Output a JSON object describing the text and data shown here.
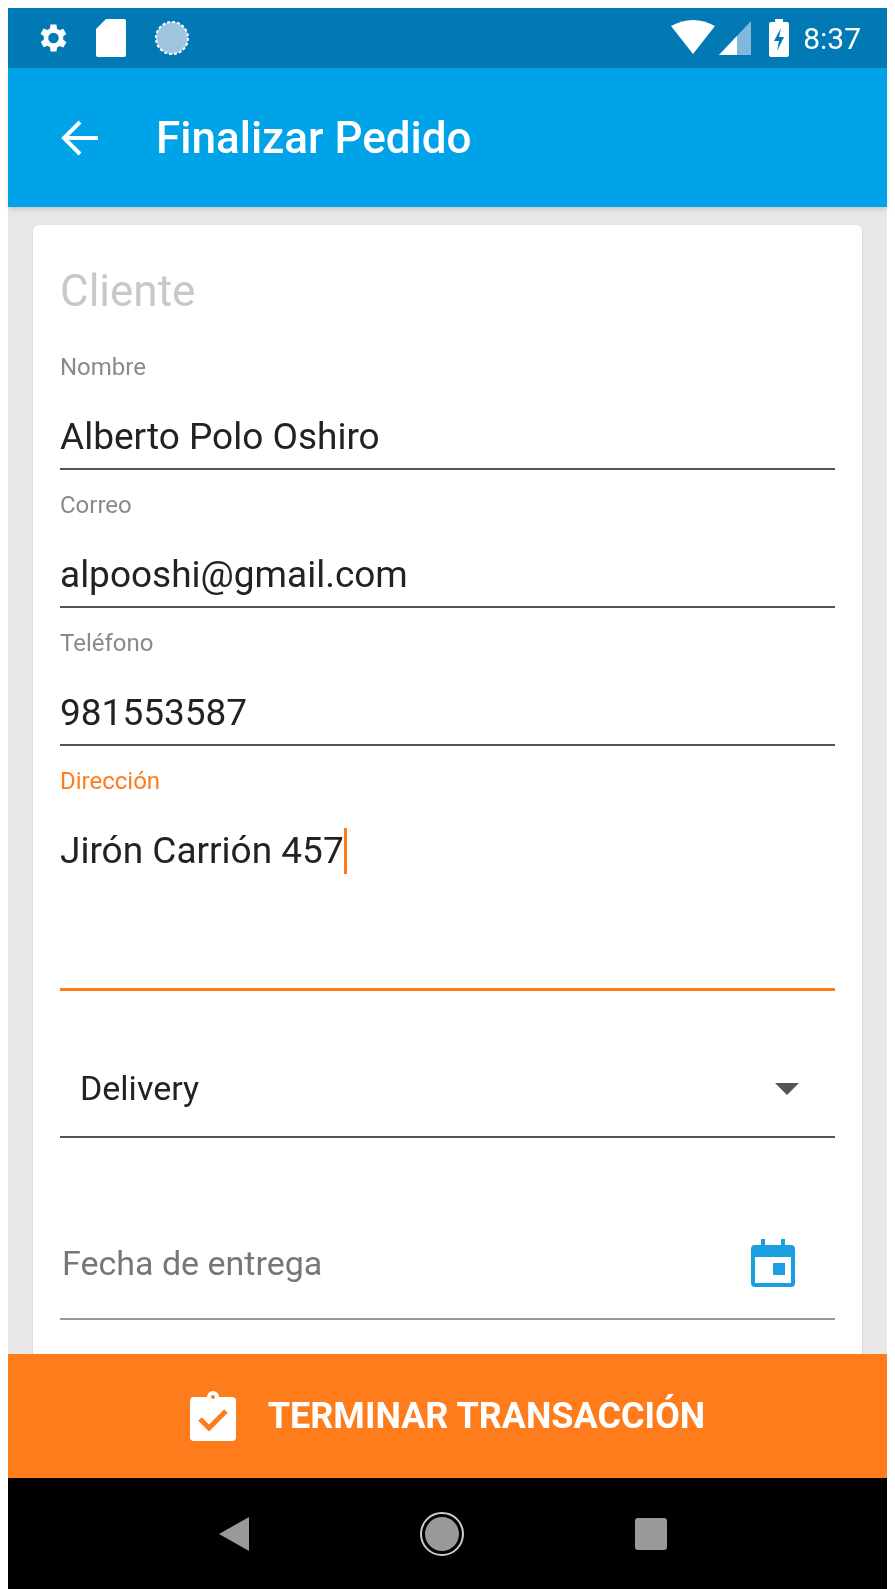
{
  "status_bar": {
    "time": "8:37"
  },
  "app_bar": {
    "title": "Finalizar Pedido"
  },
  "form": {
    "section_title": "Cliente",
    "fields": [
      {
        "label": "Nombre",
        "value": "Alberto Polo Oshiro",
        "focused": false,
        "multiline": false
      },
      {
        "label": "Correo",
        "value": "alpooshi@gmail.com",
        "focused": false,
        "multiline": false
      },
      {
        "label": "Teléfono",
        "value": "981553587",
        "focused": false,
        "multiline": false
      },
      {
        "label": "Dirección",
        "value": "Jirón Carrión 457",
        "focused": true,
        "multiline": true
      }
    ],
    "delivery_select": {
      "value": "Delivery"
    },
    "date_field": {
      "placeholder": "Fecha de entrega"
    }
  },
  "action_button": {
    "label": "TERMINAR TRANSACCIÓN"
  }
}
